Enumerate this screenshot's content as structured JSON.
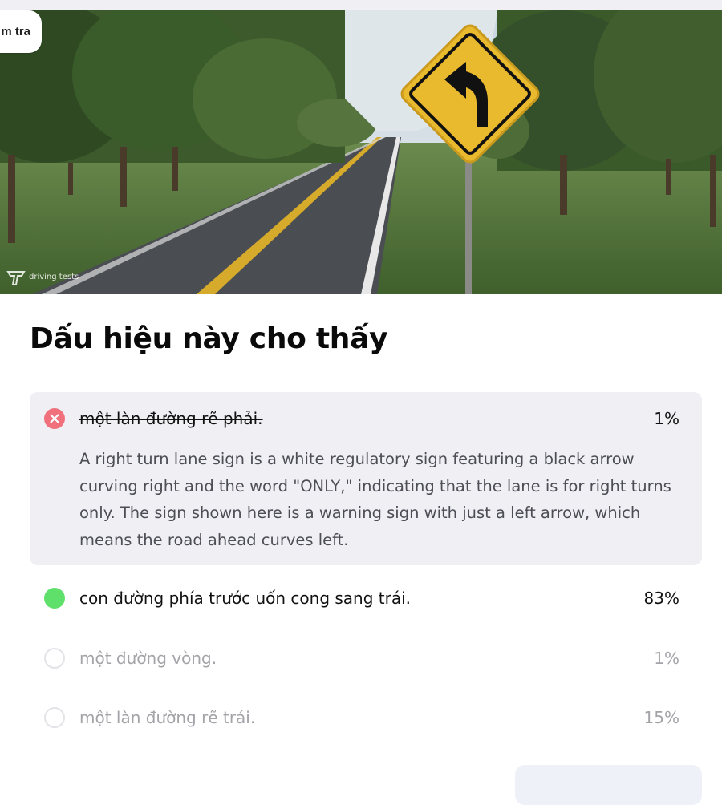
{
  "header": {
    "tab_label": "m tra",
    "watermark": "driving tests"
  },
  "question": {
    "title": "Dấu hiệu này cho thấy"
  },
  "options": [
    {
      "label": "một làn đường rẽ phải.",
      "percent": "1%",
      "state": "wrong",
      "explanation": "A right turn lane sign is a white regulatory sign featuring a black arrow curving right and the word \"ONLY,\" indicating that the lane is for right turns only. The sign shown here is a warning sign with just a left arrow, which means the road ahead curves left."
    },
    {
      "label": "con đường phía trước uốn cong sang trái.",
      "percent": "83%",
      "state": "correct"
    },
    {
      "label": "một đường vòng.",
      "percent": "1%",
      "state": "neutral"
    },
    {
      "label": "một làn đường rẽ trái.",
      "percent": "15%",
      "state": "neutral"
    }
  ],
  "colors": {
    "wrong": "#f0707c",
    "correct": "#5ee06a",
    "panel": "#efeff4",
    "muted_text": "#a3a3a8",
    "sign_yellow": "#e9b92e"
  },
  "icons": {
    "wrong_marker": "x-circle-icon",
    "correct_marker": "filled-circle-icon",
    "sign_arrow": "curve-left-arrow-icon"
  }
}
